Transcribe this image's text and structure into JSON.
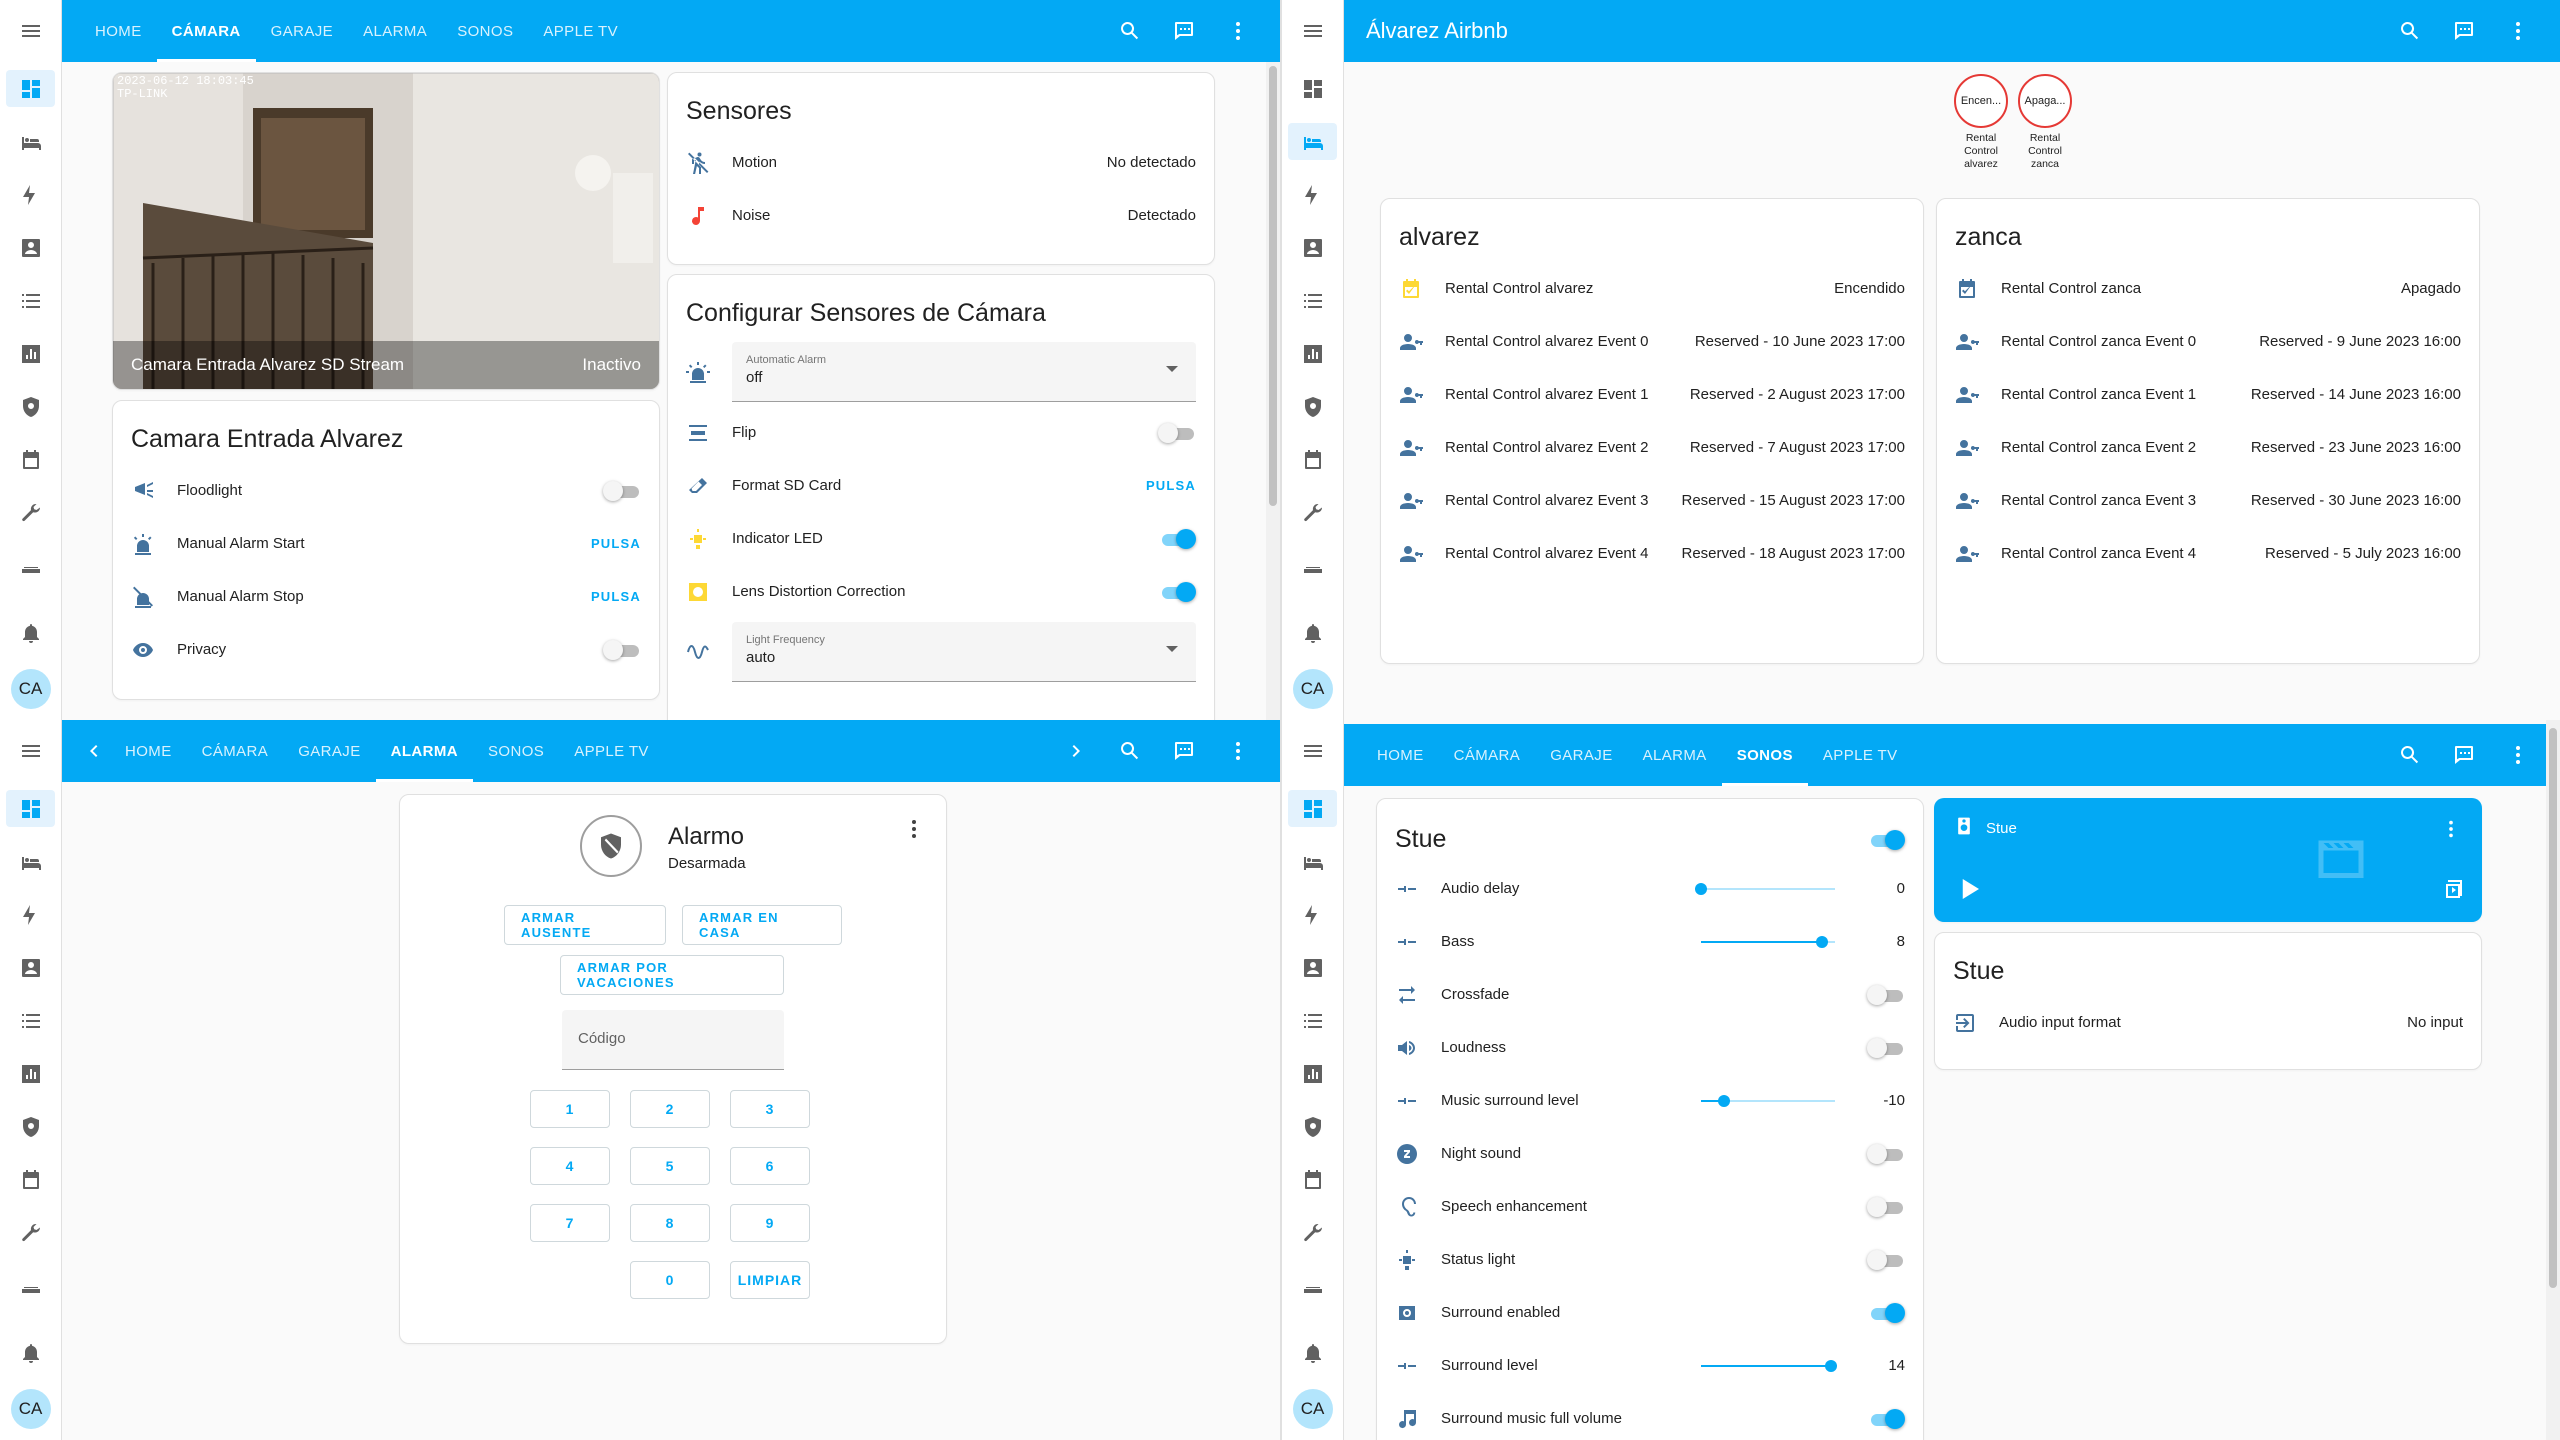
{
  "topbar_tabs": [
    "HOME",
    "CÁMARA",
    "GARAJE",
    "ALARMA",
    "SONOS",
    "APPLE TV"
  ],
  "avatar": "CA",
  "q1": {
    "active_tab": "CÁMARA",
    "camera": {
      "timestamp": "2023-06-12 18:03:45",
      "overlay": "TP-LINK",
      "name": "Camara Entrada Alvarez SD Stream",
      "state": "Inactivo"
    },
    "camera_card": {
      "title": "Camara Entrada Alvarez",
      "rows": [
        {
          "label": "Floodlight",
          "icon": "floodlight-icon",
          "type": "toggle",
          "on": false
        },
        {
          "label": "Manual Alarm Start",
          "icon": "alarm-light-icon",
          "type": "button",
          "value": "PULSA"
        },
        {
          "label": "Manual Alarm Stop",
          "icon": "alarm-light-off-icon",
          "type": "button",
          "value": "PULSA"
        },
        {
          "label": "Privacy",
          "icon": "eye-icon",
          "type": "toggle",
          "on": false
        }
      ]
    },
    "sensors": {
      "title": "Sensores",
      "rows": [
        {
          "label": "Motion",
          "value": "No detectado",
          "icon": "motion-sensor-off-icon"
        },
        {
          "label": "Noise",
          "value": "Detectado",
          "icon": "music-note-icon"
        }
      ]
    },
    "config": {
      "title": "Configurar Sensores de Cámara",
      "auto_alarm": {
        "label": "Automatic Alarm",
        "value": "off"
      },
      "rows": [
        {
          "label": "Flip",
          "type": "toggle",
          "on": false,
          "icon": "flip-icon"
        },
        {
          "label": "Format SD Card",
          "type": "button",
          "value": "PULSA",
          "icon": "eraser-icon"
        },
        {
          "label": "Indicator LED",
          "type": "toggle",
          "on": true,
          "icon": "led-icon"
        },
        {
          "label": "Lens Distortion Correction",
          "type": "toggle",
          "on": true,
          "icon": "lens-icon"
        }
      ],
      "light_freq": {
        "label": "Light Frequency",
        "value": "auto"
      }
    }
  },
  "q2": {
    "title": "Álvarez Airbnb",
    "badges": [
      {
        "state": "Encen...",
        "name": "Rental Control alvarez"
      },
      {
        "state": "Apaga...",
        "name": "Rental Control zanca"
      }
    ],
    "cards": [
      {
        "title": "alvarez",
        "rows": [
          {
            "label": "Rental Control alvarez",
            "value": "Encendido"
          },
          {
            "label": "Rental Control alvarez Event 0",
            "value": "Reserved - 10 June 2023 17:00"
          },
          {
            "label": "Rental Control alvarez Event 1",
            "value": "Reserved - 2 August 2023 17:00"
          },
          {
            "label": "Rental Control alvarez Event 2",
            "value": "Reserved - 7 August 2023 17:00"
          },
          {
            "label": "Rental Control alvarez Event 3",
            "value": "Reserved - 15 August 2023 17:00"
          },
          {
            "label": "Rental Control alvarez Event 4",
            "value": "Reserved - 18 August 2023 17:00"
          }
        ]
      },
      {
        "title": "zanca",
        "rows": [
          {
            "label": "Rental Control zanca",
            "value": "Apagado"
          },
          {
            "label": "Rental Control zanca Event 0",
            "value": "Reserved - 9 June 2023 16:00"
          },
          {
            "label": "Rental Control zanca Event 1",
            "value": "Reserved - 14 June 2023 16:00"
          },
          {
            "label": "Rental Control zanca Event 2",
            "value": "Reserved - 23 June 2023 16:00"
          },
          {
            "label": "Rental Control zanca Event 3",
            "value": "Reserved - 30 June 2023 16:00"
          },
          {
            "label": "Rental Control zanca Event 4",
            "value": "Reserved - 5 July 2023 16:00"
          }
        ]
      }
    ]
  },
  "q3": {
    "active_tab": "ALARMA",
    "alarm": {
      "name": "Alarmo",
      "state": "Desarmada",
      "btn_away": "ARMAR AUSENTE",
      "btn_home": "ARMAR EN CASA",
      "btn_vacation": "ARMAR POR VACACIONES",
      "code_placeholder": "Código",
      "keys": [
        "1",
        "2",
        "3",
        "4",
        "5",
        "6",
        "7",
        "8",
        "9",
        "0"
      ],
      "clear": "LIMPIAR"
    }
  },
  "q4": {
    "active_tab": "SONOS",
    "stue": {
      "title": "Stue",
      "master_on": true,
      "rows": [
        {
          "label": "Audio delay",
          "type": "slider",
          "value": "0",
          "fraction": 0.0,
          "icon": "tune-icon"
        },
        {
          "label": "Bass",
          "type": "slider",
          "value": "8",
          "fraction": 0.9,
          "icon": "tune-icon"
        },
        {
          "label": "Crossfade",
          "type": "toggle",
          "on": false,
          "icon": "swap-icon"
        },
        {
          "label": "Loudness",
          "type": "toggle",
          "on": false,
          "icon": "speaker-icon"
        },
        {
          "label": "Music surround level",
          "type": "slider",
          "value": "-10",
          "fraction": 0.17,
          "icon": "tune-icon"
        },
        {
          "label": "Night sound",
          "type": "toggle",
          "on": false,
          "icon": "sleep-icon"
        },
        {
          "label": "Speech enhancement",
          "type": "toggle",
          "on": false,
          "icon": "ear-icon"
        },
        {
          "label": "Status light",
          "type": "toggle",
          "on": false,
          "icon": "led-icon"
        },
        {
          "label": "Surround enabled",
          "type": "toggle",
          "on": true,
          "icon": "surround-icon"
        },
        {
          "label": "Surround level",
          "type": "slider",
          "value": "14",
          "fraction": 0.97,
          "icon": "tune-icon"
        },
        {
          "label": "Surround music full volume",
          "type": "toggle",
          "on": true,
          "icon": "music-icon"
        }
      ]
    },
    "player": {
      "name": "Stue"
    },
    "stue2": {
      "title": "Stue",
      "row": {
        "label": "Audio input format",
        "value": "No input"
      }
    }
  }
}
